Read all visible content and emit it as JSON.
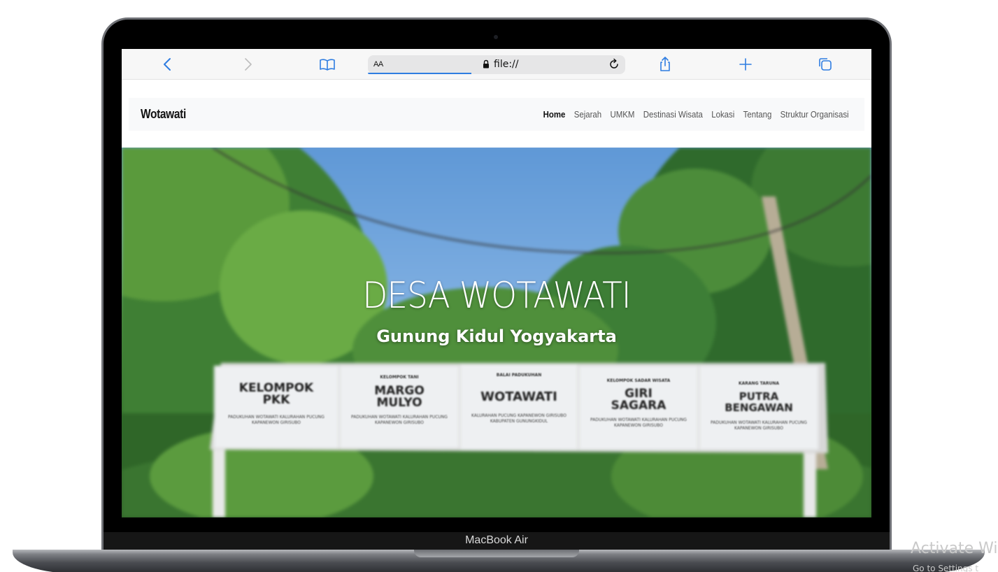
{
  "device": {
    "label": "MacBook Air"
  },
  "browser": {
    "text_size_label": "AA",
    "url": "file://"
  },
  "site": {
    "brand": "Wotawati",
    "nav": [
      {
        "label": "Home",
        "active": true
      },
      {
        "label": "Sejarah",
        "active": false
      },
      {
        "label": "UMKM",
        "active": false
      },
      {
        "label": "Destinasi Wisata",
        "active": false
      },
      {
        "label": "Lokasi",
        "active": false
      },
      {
        "label": "Tentang",
        "active": false
      },
      {
        "label": "Struktur Organisasi",
        "active": false
      }
    ],
    "hero": {
      "title": "DESA WOTAWATI",
      "subtitle": "Gunung Kidul Yogyakarta"
    }
  },
  "signboards": [
    {
      "small": "",
      "title": "KELOMPOK\nPKK",
      "lines": "PADUKUHAN WOTAWATI KALURAHAN PUCUNG KAPANEWON GIRISUBO"
    },
    {
      "small": "KELOMPOK TANI",
      "title": "MARGO\nMULYO",
      "lines": "PADUKUHAN WOTAWATI KALURAHAN PUCUNG KAPANEWON GIRISUBO"
    },
    {
      "small": "BALAI PADUKUHAN",
      "title": "WOTAWATI",
      "lines": "KALURAHAN PUCUNG KAPANEWON GIRISUBO KABUPATEN GUNUNGKIDUL"
    },
    {
      "small": "KELOMPOK SADAR WISATA",
      "title": "GIRI\nSAGARA",
      "lines": "PADUKUHAN WOTAWATI KALURAHAN PUCUNG KAPANEWON GIRISUBO"
    },
    {
      "small": "KARANG TARUNA",
      "title": "PUTRA\nBENGAWAN",
      "lines": "PADUKUHAN WOTAWATI KALURAHAN PUCUNG KAPANEWON GIRISUBO"
    }
  ],
  "os_watermark": {
    "title": "Activate Wi",
    "subtitle": "Go to Settings t"
  },
  "colors": {
    "link_blue": "#2f7de1",
    "nav_bg": "#f8f9fa"
  }
}
